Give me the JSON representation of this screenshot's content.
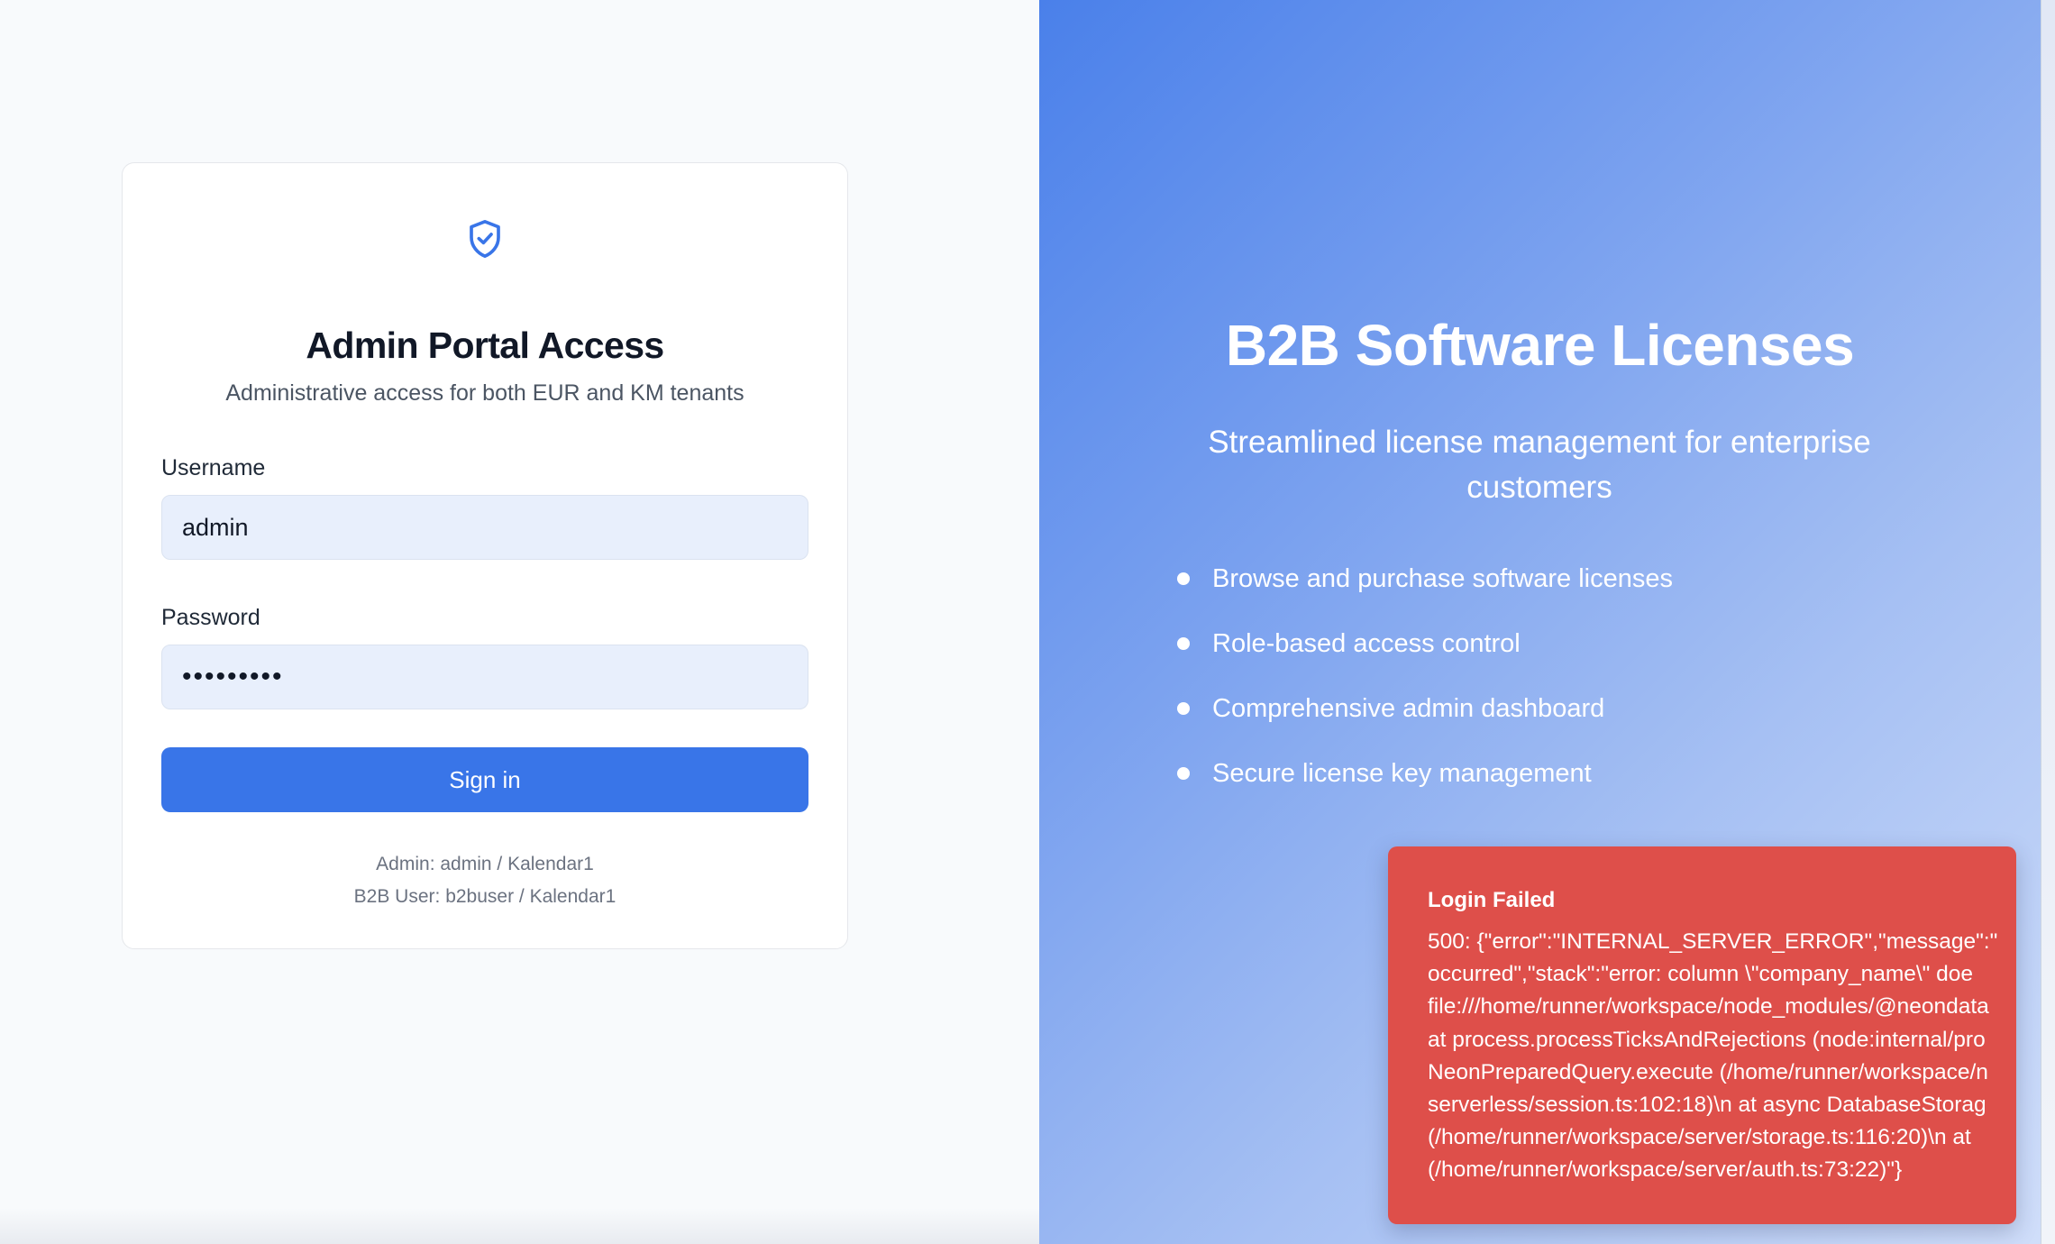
{
  "login_card": {
    "icon": "shield-check-icon",
    "title": "Admin Portal Access",
    "subtitle": "Administrative access for both EUR and KM tenants",
    "username_label": "Username",
    "username_value": "admin",
    "password_label": "Password",
    "password_value": "•••••••••",
    "signin_label": "Sign in",
    "hint_admin": "Admin: admin / Kalendar1",
    "hint_b2b": "B2B User: b2buser / Kalendar1"
  },
  "hero": {
    "title": "B2B Software Licenses",
    "subtitle": "Streamlined license management for enterprise customers",
    "features": [
      "Browse and purchase software licenses",
      "Role-based access control",
      "Comprehensive admin dashboard",
      "Secure license key management"
    ]
  },
  "toast": {
    "title": "Login Failed",
    "lines": [
      "500: {\"error\":\"INTERNAL_SERVER_ERROR\",\"message\":\"",
      "occurred\",\"stack\":\"error: column \\\"company_name\\\" doe",
      "file:///home/runner/workspace/node_modules/@neondata",
      "at process.processTicksAndRejections (node:internal/pro",
      "NeonPreparedQuery.execute (/home/runner/workspace/n",
      "serverless/session.ts:102:18)\\n at async DatabaseStorag",
      "(/home/runner/workspace/server/storage.ts:116:20)\\n at",
      "(/home/runner/workspace/server/auth.ts:73:22)\"}"
    ]
  },
  "colors": {
    "primary": "#3975e8",
    "input_bg": "#e8effc",
    "toast_bg": "#de4f4a",
    "hero_gradient_start": "#4a80ea",
    "hero_gradient_end": "#d0defa"
  }
}
